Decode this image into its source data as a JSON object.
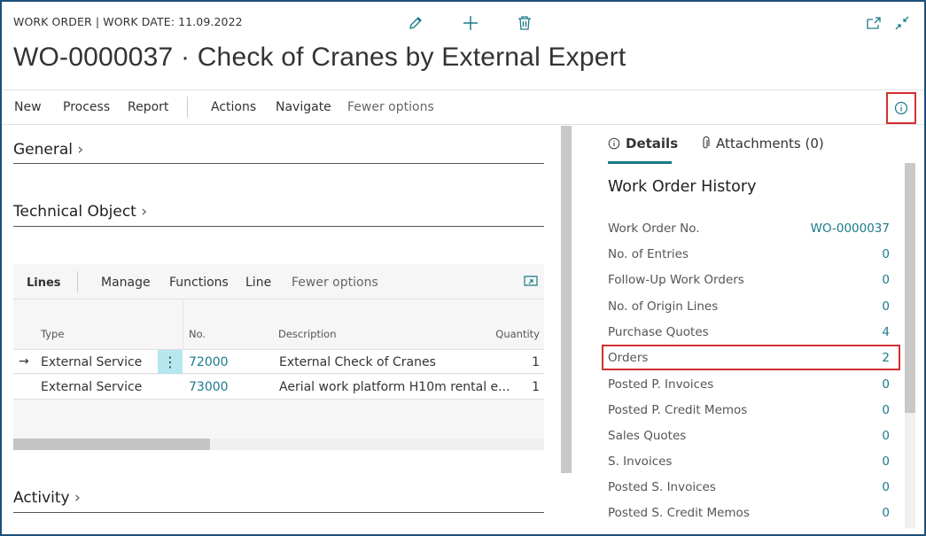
{
  "header": {
    "caption": "WORK ORDER | WORK DATE: 11.09.2022",
    "title": "WO-0000037 · Check of Cranes by External Expert",
    "icons": [
      "edit-icon",
      "add-icon",
      "delete-icon",
      "open-new-window-icon",
      "collapse-icon"
    ]
  },
  "actionbar": {
    "new": "New",
    "process": "Process",
    "report": "Report",
    "actions": "Actions",
    "navigate": "Navigate",
    "fewer": "Fewer options"
  },
  "sections": {
    "general": "General",
    "technical_object": "Technical Object",
    "activity": "Activity"
  },
  "lines": {
    "toolbar": {
      "lines": "Lines",
      "manage": "Manage",
      "functions": "Functions",
      "line": "Line",
      "fewer": "Fewer options"
    },
    "columns": {
      "type": "Type",
      "no": "No.",
      "description": "Description",
      "quantity": "Quantity"
    },
    "rows": [
      {
        "type": "External Service",
        "no": "72000",
        "description": "External Check of Cranes",
        "quantity": "1"
      },
      {
        "type": "External Service",
        "no": "73000",
        "description": "Aerial work platform H10m rental e...",
        "quantity": "1"
      }
    ]
  },
  "factbox": {
    "tab_details": "Details",
    "tab_attachments": "Attachments (0)",
    "title": "Work Order History",
    "rows": [
      {
        "label": "Work Order No.",
        "value": "WO-0000037"
      },
      {
        "label": "No. of Entries",
        "value": "0"
      },
      {
        "label": "Follow-Up Work Orders",
        "value": "0"
      },
      {
        "label": "No. of Origin Lines",
        "value": "0"
      },
      {
        "label": "Purchase Quotes",
        "value": "4"
      },
      {
        "label": "Orders",
        "value": "2"
      },
      {
        "label": "Posted P. Invoices",
        "value": "0"
      },
      {
        "label": "Posted P. Credit Memos",
        "value": "0"
      },
      {
        "label": "Sales Quotes",
        "value": "0"
      },
      {
        "label": "S. Invoices",
        "value": "0"
      },
      {
        "label": "Posted S. Invoices",
        "value": "0"
      },
      {
        "label": "Posted S. Credit Memos",
        "value": "0"
      }
    ]
  },
  "colors": {
    "accent": "#1a7a8a",
    "highlight": "#d32f2f",
    "frame": "#1f4e79"
  }
}
